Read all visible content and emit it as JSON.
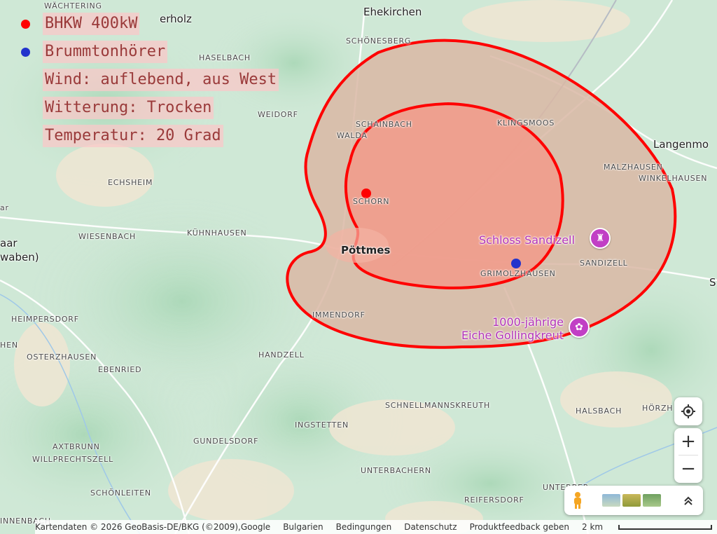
{
  "legend": [
    {
      "label": "BHKW  400kW",
      "dot_color": "#ff0000"
    },
    {
      "label": "Brummtonhörer",
      "dot_color": "#2233cc"
    },
    {
      "label": "Wind: auflebend, aus West",
      "dot_color": ""
    },
    {
      "label": "Witterung: Trocken",
      "dot_color": ""
    },
    {
      "label": "Temperatur: 20 Grad",
      "dot_color": ""
    }
  ],
  "places": {
    "waechtering": "WÄCHTERING",
    "erholz": "erholz",
    "ehekirchen": "Ehekirchen",
    "schoenesberg": "SCHÖNESBERG",
    "haselbach": "HASELBACH",
    "weidorf": "WEIDORF",
    "schainbach": "SCHAINBACH",
    "walda": "WALDA",
    "klingsmoos": "KLINGSMOOS",
    "langenmo": "Langenmo",
    "malzhausen": "MALZHAUSEN",
    "winkelhausen": "WINKELHAUSEN",
    "echsheim": "ECHSHEIM",
    "schorn": "SCHORN",
    "ar": "ar",
    "kuehnhausen": "KÜHNHAUSEN",
    "wiesenbach": "WIESENBACH",
    "aar": "aar",
    "waben": "waben)",
    "poettmes": "Pöttmes",
    "grimolzhausen": "GRIMOLZHAUSEN",
    "sandizell": "SANDIZELL",
    "s_edge": "S",
    "immendorf": "IMMENDORF",
    "heimpersdorf": "HEIMPERSDORF",
    "hen": "HEN",
    "osterzhausen": "OSTERZHAUSEN",
    "ebenried": "EBENRIED",
    "handzell": "HANDZELL",
    "schnellmannskreuth": "SCHNELLMANNSKREUTH",
    "halsbach": "HALSBACH",
    "hoerzh": "HÖRZH",
    "ingstetten": "INGSTETTEN",
    "gundelsdorf": "GUNDELSDORF",
    "axtbrunn": "AXTBRUNN",
    "willprechtszell": "WILLPRECHTSZELL",
    "unterbachern": "UNTERBACHERN",
    "schoenleiten": "SCHÖNLEITEN",
    "unterberg": "UNTERBER",
    "reifersdorf": "REIFERSDORF",
    "innenbach": "INNENBACH"
  },
  "pois": {
    "schloss": "Schloss Sandizell",
    "eiche_line1": "1000-jährige",
    "eiche_line2": "Eiche Gollingkreut"
  },
  "icons": {
    "castle": "castle-icon",
    "tree": "landmark-icon",
    "locate": "my-location-icon",
    "pegman": "pegman-icon",
    "expand": "chevron-up-double-icon"
  },
  "controls": {
    "zoom_in": "+",
    "zoom_out": "−",
    "expand": "⌃"
  },
  "footer": {
    "attribution": "Kartendaten © 2026 GeoBasis-DE/BKG (©2009),Google",
    "country": "Bulgarien",
    "terms": "Bedingungen",
    "privacy": "Datenschutz",
    "feedback": "Produktfeedback geben",
    "scale": "2 km"
  },
  "colors": {
    "outline": "#ff0000",
    "inner_fill": "#f29a8a",
    "outer_fill": "#d9b7a4",
    "bhkw_dot": "#ff0000",
    "listener_dot": "#2233cc",
    "poi": "#b232b8"
  }
}
